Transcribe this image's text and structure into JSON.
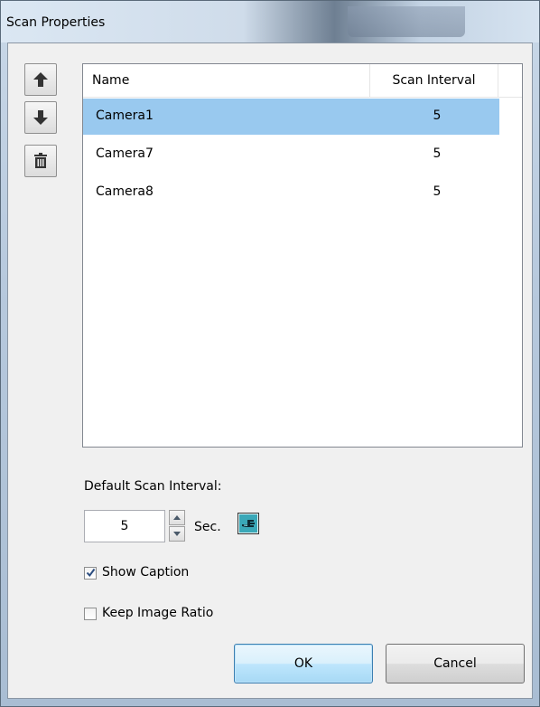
{
  "window": {
    "title": "Scan Properties"
  },
  "list": {
    "columns": {
      "name": "Name",
      "interval": "Scan Interval"
    },
    "rows": [
      {
        "name": "Camera1",
        "interval": "5",
        "selected": true
      },
      {
        "name": "Camera7",
        "interval": "5",
        "selected": false
      },
      {
        "name": "Camera8",
        "interval": "5",
        "selected": false
      }
    ]
  },
  "side_buttons": {
    "up": "arrow-up-icon",
    "down": "arrow-down-icon",
    "delete": "trash-icon"
  },
  "default_scan": {
    "label": "Default Scan Interval:",
    "value": "5",
    "unit": "Sec."
  },
  "options": {
    "show_caption": {
      "label": "Show Caption",
      "checked": true
    },
    "keep_ratio": {
      "label": "Keep Image Ratio",
      "checked": false
    }
  },
  "buttons": {
    "ok": "OK",
    "cancel": "Cancel"
  },
  "colors": {
    "selection": "#99c9ef",
    "ok_border": "#3c7fb1"
  }
}
